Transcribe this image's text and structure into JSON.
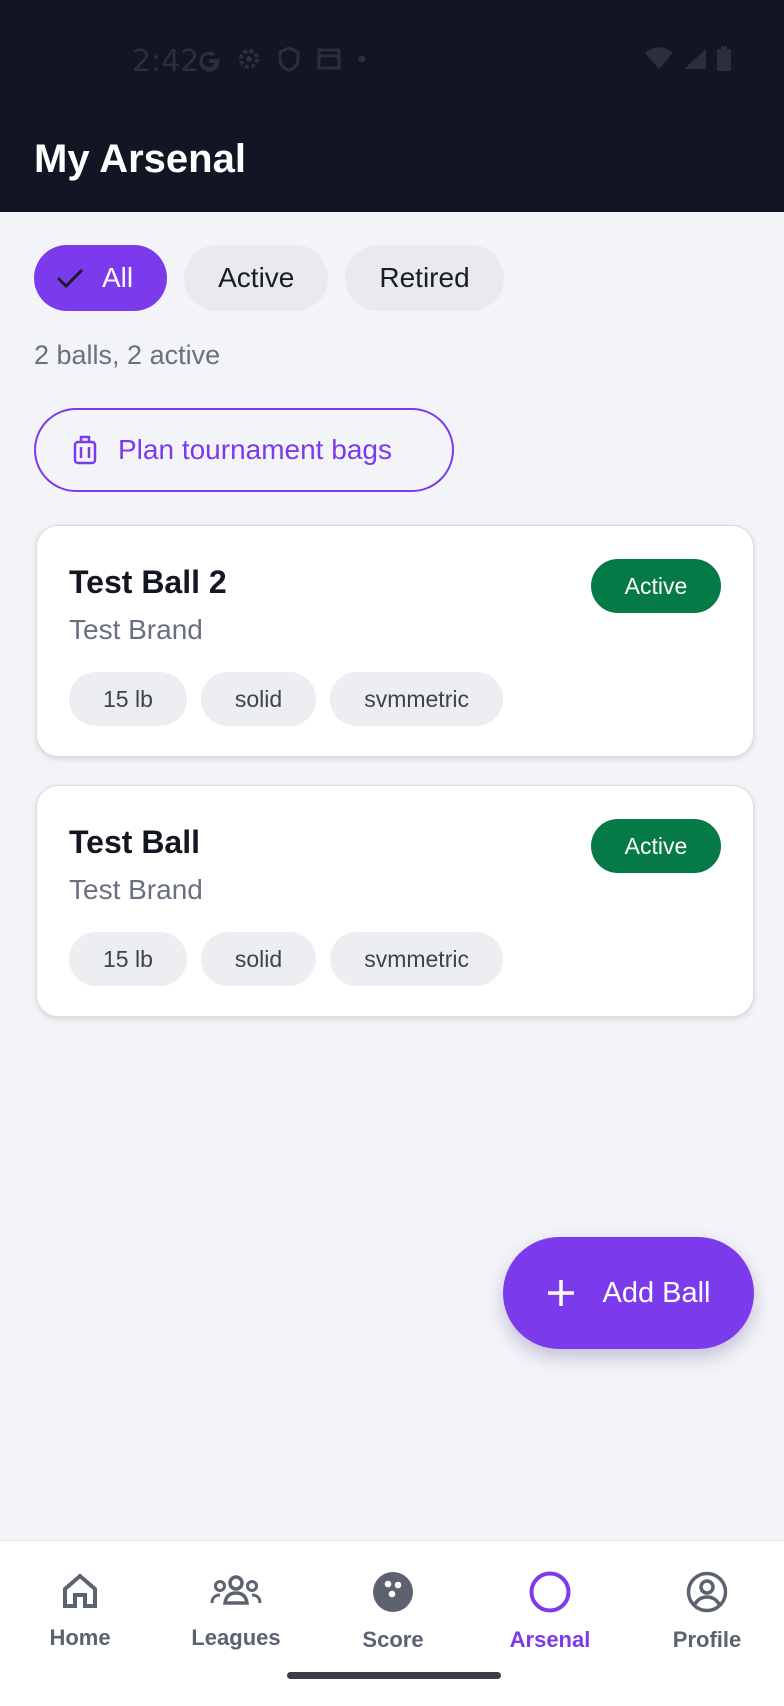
{
  "status_bar": {
    "time": "2:42"
  },
  "app_bar": {
    "title": "My Arsenal"
  },
  "filters": [
    {
      "label": "All",
      "selected": true
    },
    {
      "label": "Active",
      "selected": false
    },
    {
      "label": "Retired",
      "selected": false
    }
  ],
  "summary": "2 balls, 2 active",
  "plan_button": {
    "label": "Plan tournament bags",
    "icon": "luggage-icon"
  },
  "balls": [
    {
      "name": "Test Ball 2",
      "brand": "Test Brand",
      "status": "Active",
      "tags": [
        "15 lb",
        "solid",
        "svmmetric"
      ]
    },
    {
      "name": "Test Ball",
      "brand": "Test Brand",
      "status": "Active",
      "tags": [
        "15 lb",
        "solid",
        "svmmetric"
      ]
    }
  ],
  "fab": {
    "label": "Add Ball",
    "icon": "plus-icon"
  },
  "nav": [
    {
      "label": "Home",
      "icon": "home-icon",
      "active": false
    },
    {
      "label": "Leagues",
      "icon": "group-icon",
      "active": false
    },
    {
      "label": "Score",
      "icon": "bowling-ball-icon",
      "active": false
    },
    {
      "label": "Arsenal",
      "icon": "circle-icon",
      "active": true
    },
    {
      "label": "Profile",
      "icon": "account-circle-icon",
      "active": false
    }
  ],
  "colors": {
    "accent": "#7c3aed",
    "active_badge": "#067a46",
    "header": "#111524"
  }
}
